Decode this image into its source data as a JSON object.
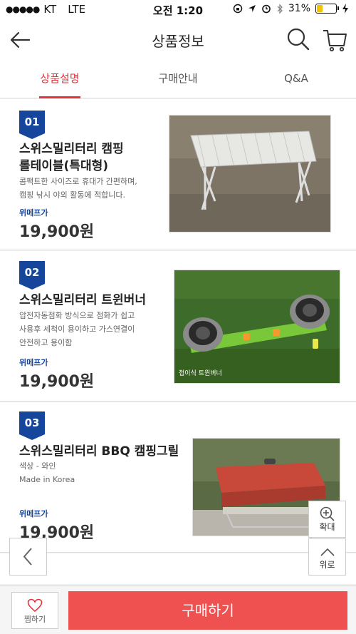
{
  "status": {
    "carrier": "KT",
    "network": "LTE",
    "time": "오전 1:20",
    "battery": "31%",
    "battery_level": 0.31
  },
  "header": {
    "title": "상품정보"
  },
  "tabs": [
    {
      "label": "상품설명",
      "active": true
    },
    {
      "label": "구매안내",
      "active": false
    },
    {
      "label": "Q&A",
      "active": false
    }
  ],
  "products": [
    {
      "num": "01",
      "name_line1": "스위스밀리터리 캠핑",
      "name_line2": "롤테이블(특대형)",
      "desc_line1": "콤팩트한 사이즈로 휴대가 간편하며,",
      "desc_line2": "캠핑 낚시 야외 활동에 적합니다.",
      "desc_line3": "",
      "price_label": "위메프가",
      "price": "19,900원"
    },
    {
      "num": "02",
      "name_line1": "스위스밀리터리 트윈버너",
      "name_line2": "",
      "desc_line1": "압전자동점화 방식으로 점화가 쉽고",
      "desc_line2": "사용후 세척이 용이하고 가스연결이",
      "desc_line3": "안전하고 용이함",
      "price_label": "위메프가",
      "price": "19,900원",
      "image_caption": "접이식 트윈버너"
    },
    {
      "num": "03",
      "name_line1": "스위스밀리터리 BBQ 캠핑그릴",
      "name_line2": "",
      "desc_line1": "색상 - 와인",
      "desc_line2": "Made in Korea",
      "desc_line3": "",
      "price_label": "위메프가",
      "price": "19,900원"
    }
  ],
  "floating": {
    "zoom_label": "확대",
    "top_label": "위로"
  },
  "bottom": {
    "wish_label": "찜하기",
    "buy_label": "구매하기"
  },
  "colors": {
    "accent": "#e8303a",
    "badge": "#16469c",
    "buy_button": "#ef5151"
  }
}
